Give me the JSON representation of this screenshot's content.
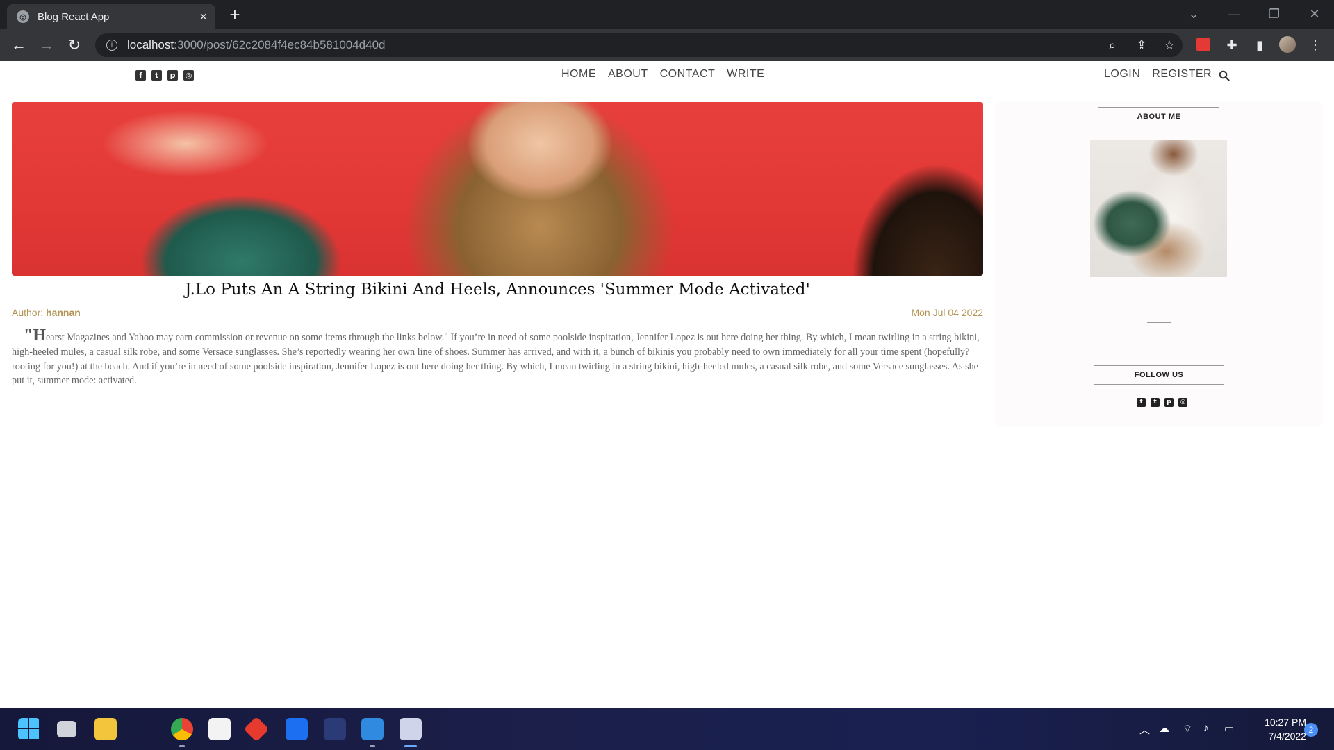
{
  "browser": {
    "tab_title": "Blog React App",
    "url_host": "localhost",
    "url_path": ":3000/post/62c2084f4ec84b581004d40d",
    "new_tab_label": "+",
    "close_tab_label": "×"
  },
  "site": {
    "social_icons": [
      "facebook-icon",
      "twitter-icon",
      "pinterest-icon",
      "instagram-icon"
    ],
    "menu": [
      "HOME",
      "ABOUT",
      "CONTACT",
      "WRITE"
    ],
    "auth": [
      "LOGIN",
      "REGISTER"
    ]
  },
  "post": {
    "title": "J.Lo Puts An A String Bikini And Heels, Announces 'Summer Mode Activated'",
    "author_label": "Author: ",
    "author_name": "hannan",
    "date": "Mon Jul 04 2022",
    "dropcap": "\"H",
    "body": "earst Magazines and Yahoo may earn commission or revenue on some items through the links below.\" If you’re in need of some poolside inspiration, Jennifer Lopez is out here doing her thing. By which, I mean twirling in a string bikini, high-heeled mules, a casual silk robe, and some Versace sunglasses. She’s reportedly wearing her own line of shoes. Summer has arrived, and with it, a bunch of bikinis you probably need to own immediately for all your time spent (hopefully? rooting for you!) at the beach. And if you’re in need of some poolside inspiration, Jennifer Lopez is out here doing her thing. By which, I mean twirling in a string bikini, high-heeled mules, a casual silk robe, and some Versace sunglasses. As she put it, summer mode: activated."
  },
  "sidebar": {
    "about_title": "ABOUT ME",
    "follow_title": "FOLLOW US"
  },
  "taskbar": {
    "time": "10:27 PM",
    "date": "7/4/2022",
    "notifications": "2"
  },
  "colors": {
    "accent": "#b39656",
    "chrome_dark": "#202124",
    "chrome_toolbar": "#35363a"
  }
}
